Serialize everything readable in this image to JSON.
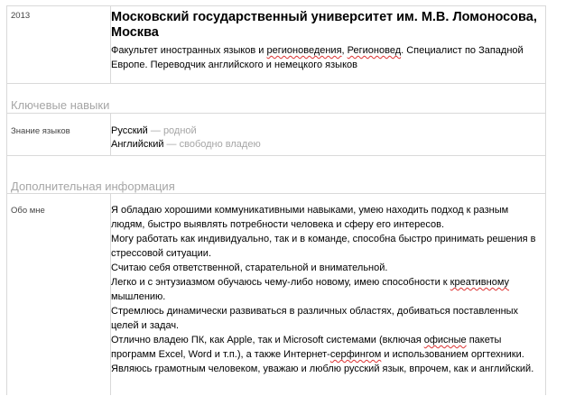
{
  "education": {
    "year": "2013",
    "university": "Московский государственный университет им. М.В. Ломоносова, Москва",
    "description_parts": [
      {
        "text": "Факультет иностранных языков и ",
        "spell": false
      },
      {
        "text": "регионоведения",
        "spell": true
      },
      {
        "text": ", ",
        "spell": false
      },
      {
        "text": "Регионовед",
        "spell": true
      },
      {
        "text": ". Специалист по Западной Европе. Переводчик английского и немецкого языков",
        "spell": false
      }
    ]
  },
  "skills": {
    "section_title": "Ключевые навыки",
    "label": "Знание языков",
    "languages": [
      {
        "name": "Русский",
        "level": "— родной"
      },
      {
        "name": "Английский",
        "level": "— свободно владею"
      }
    ]
  },
  "additional": {
    "section_title": "Дополнительная информация",
    "label": "Обо мне",
    "paragraphs": [
      [
        {
          "text": "Я обладаю хорошими коммуникативными навыками, умею находить подход к разным людям, быстро выявлять потребности человека и сферу его интересов.",
          "spell": false
        }
      ],
      [
        {
          "text": "Могу работать как индивидуально, так и в команде, способна быстро принимать решения в стрессовой ситуации.",
          "spell": false
        }
      ],
      [
        {
          "text": "Считаю себя ответственной, старательной и внимательной.",
          "spell": false
        }
      ],
      [
        {
          "text": "Легко и с энтузиазмом обучаюсь чему-либо новому, имею способности к ",
          "spell": false
        },
        {
          "text": "креативному",
          "spell": true
        },
        {
          "text": " мышлению.",
          "spell": false
        }
      ],
      [
        {
          "text": "Стремлюсь динамически развиваться в различных областях, добиваться поставленных целей и задач.",
          "spell": false
        }
      ],
      [
        {
          "text": "Отлично владею ПК, как Apple, так и Microsoft системами (включая ",
          "spell": false
        },
        {
          "text": "офисные",
          "spell": true
        },
        {
          "text": " пакеты программ Excel, Word и т.п.), а также Интернет-",
          "spell": false
        },
        {
          "text": "серфингом",
          "spell": true
        },
        {
          "text": " и использованием оргтехники.",
          "spell": false
        }
      ],
      [
        {
          "text": "Являюсь грамотным человеком, уважаю и люблю русский язык, впрочем, как и английский.",
          "spell": false
        }
      ]
    ]
  }
}
